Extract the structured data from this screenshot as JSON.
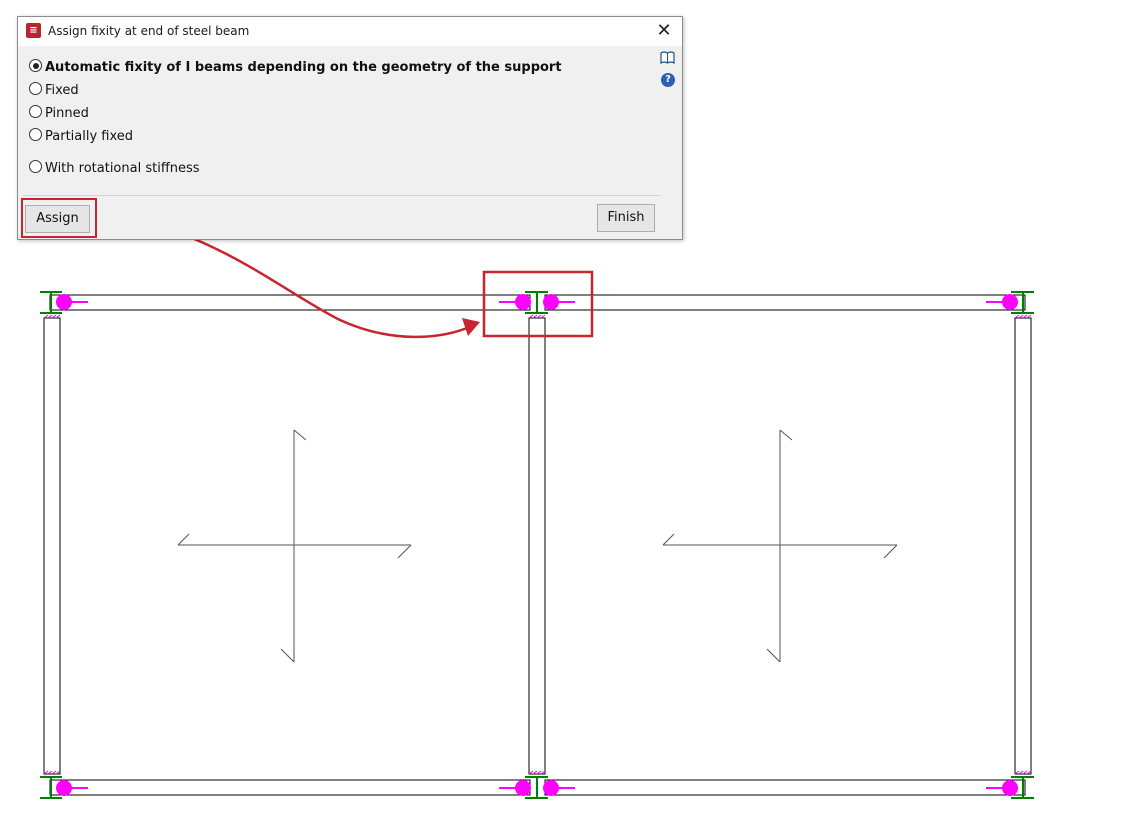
{
  "dialog": {
    "title": "Assign fixity at end of steel beam",
    "close_glyph": "✕",
    "options": [
      {
        "label": "Automatic fixity of I beams depending on the geometry of the support",
        "selected": true
      },
      {
        "label": "Fixed",
        "selected": false
      },
      {
        "label": "Pinned",
        "selected": false
      },
      {
        "label": "Partially fixed",
        "selected": false
      },
      {
        "label": "With rotational stiffness",
        "selected": false
      }
    ],
    "assign_label": "Assign",
    "finish_label": "Finish",
    "icons": [
      "app-icon",
      "book-icon",
      "help-icon",
      "close-icon"
    ]
  },
  "colors": {
    "annotation_red": "#c8262e",
    "hinge_magenta": "#ff00ff",
    "column_green": "#008000",
    "beam_line": "#000000"
  }
}
